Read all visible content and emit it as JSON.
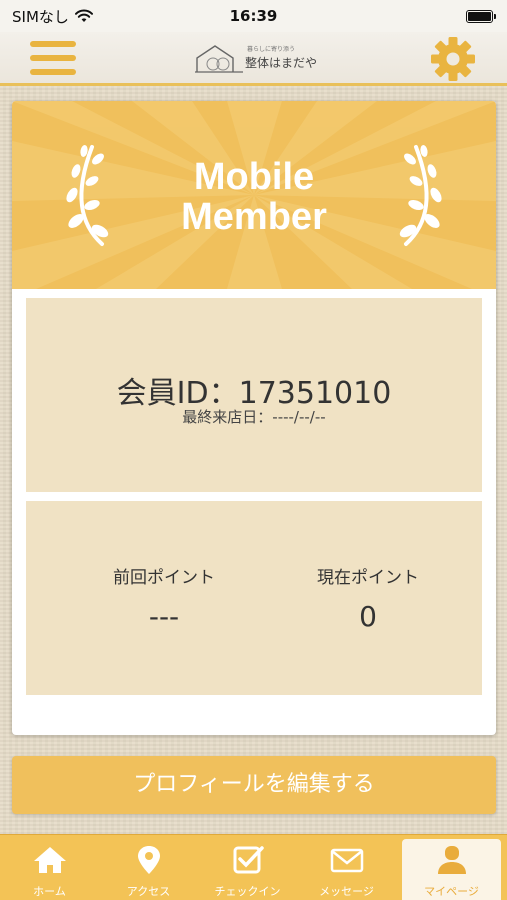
{
  "status": {
    "carrier": "SIMなし",
    "time": "16:39",
    "icons": [
      "wifi-icon",
      "battery-icon"
    ]
  },
  "header": {
    "menu_icon": "hamburger-menu-icon",
    "logo_tagline": "暮らしに寄り添う",
    "logo_name": "整体はまだや",
    "settings_icon": "gear-icon"
  },
  "banner": {
    "title_line1": "Mobile",
    "title_line2": "Member"
  },
  "member": {
    "id_text": "会員ID：17351010",
    "last_visit": "最終来店日：----/--/--"
  },
  "points": {
    "previous_label": "前回ポイント",
    "previous_value": "---",
    "current_label": "現在ポイント",
    "current_value": "0"
  },
  "edit_button": {
    "label": "プロフィールを編集する"
  },
  "tabs": [
    {
      "label": "ホーム",
      "icon": "home-icon",
      "active": false
    },
    {
      "label": "アクセス",
      "icon": "map-pin-icon",
      "active": false
    },
    {
      "label": "チェックイン",
      "icon": "checkbox-icon",
      "active": false
    },
    {
      "label": "メッセージ",
      "icon": "envelope-icon",
      "active": false
    },
    {
      "label": "マイページ",
      "icon": "person-icon",
      "active": true
    }
  ],
  "colors": {
    "accent": "#f0c05c",
    "panel": "#f0e2c4",
    "tabbar": "#f3c356",
    "active_tab_text": "#e9ac3c"
  }
}
